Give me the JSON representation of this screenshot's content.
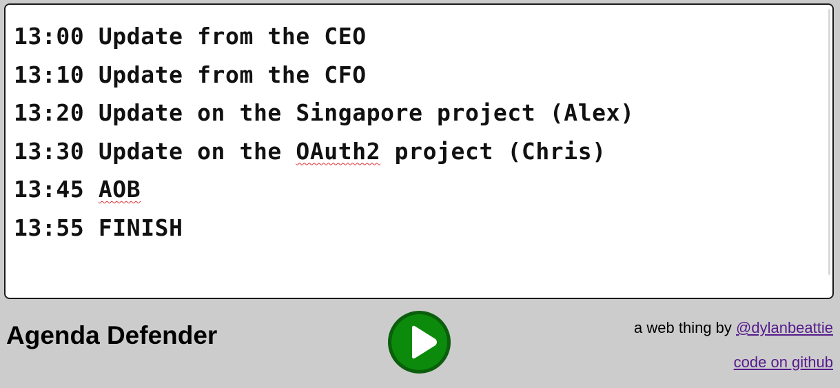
{
  "agenda": {
    "items": [
      {
        "time": "13:00",
        "title_parts": [
          {
            "text": "Update from the CEO",
            "spell": false
          }
        ]
      },
      {
        "time": "13:10",
        "title_parts": [
          {
            "text": "Update from the CFO",
            "spell": false
          }
        ]
      },
      {
        "time": "13:20",
        "title_parts": [
          {
            "text": "Update on the Singapore project (Alex)",
            "spell": false
          }
        ]
      },
      {
        "time": "13:30",
        "title_parts": [
          {
            "text": "Update on the ",
            "spell": false
          },
          {
            "text": "OAuth2",
            "spell": true
          },
          {
            "text": " project (Chris)",
            "spell": false
          }
        ]
      },
      {
        "time": "13:45",
        "title_parts": [
          {
            "text": "AOB",
            "spell": true
          }
        ]
      },
      {
        "time": "13:55",
        "title_parts": [
          {
            "text": "FINISH",
            "spell": false
          }
        ]
      }
    ]
  },
  "footer": {
    "app_title": "Agenda Defender",
    "play_icon": "play-icon",
    "credit_prefix": "a web thing by ",
    "credit_link": "@dylanbeattie",
    "github_link": "code on github"
  },
  "colors": {
    "background": "#cccccc",
    "play_fill": "#0b8a0b",
    "play_border": "#0b5e0b",
    "link": "#551a8b",
    "spellcheck": "#e03030"
  }
}
